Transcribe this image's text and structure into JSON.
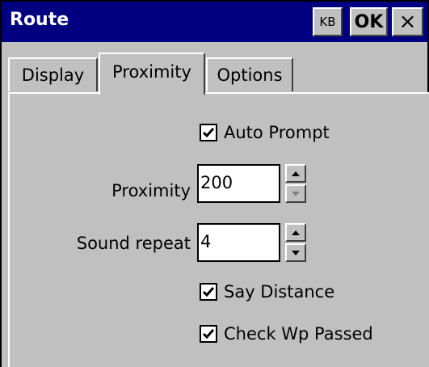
{
  "window": {
    "title": "Route"
  },
  "titlebar": {
    "kb_label": "KB",
    "ok_label": "OK",
    "close_glyph": "×"
  },
  "tabs": [
    {
      "label": "Display",
      "selected": false
    },
    {
      "label": "Proximity",
      "selected": true
    },
    {
      "label": "Options",
      "selected": false
    }
  ],
  "proximity": {
    "auto_prompt": {
      "label": "Auto Prompt",
      "checked": true
    },
    "proximity_field": {
      "label": "Proximity",
      "value": "200"
    },
    "sound_repeat_field": {
      "label": "Sound repeat",
      "value": "4"
    },
    "say_distance": {
      "label": "Say Distance",
      "checked": true
    },
    "check_wp_passed": {
      "label": "Check Wp Passed",
      "checked": true
    }
  },
  "colors": {
    "titlebar": "#000080",
    "face": "#c0c0c0"
  },
  "icons": {
    "check": "check-icon",
    "up": "up-arrow-icon",
    "down": "down-arrow-icon"
  }
}
